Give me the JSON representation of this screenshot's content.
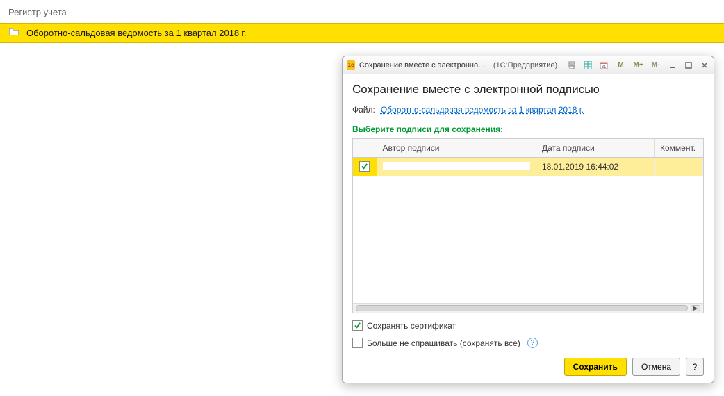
{
  "page": {
    "title": "Регистр учета"
  },
  "yellowBar": {
    "text": "Оборотно-сальдовая ведомость за 1 квартал 2018 г."
  },
  "dialog": {
    "titlePrefix": "Сохранение вместе с электронной подпи...",
    "appSuffix": "(1С:Предприятие)",
    "toolbar": {
      "m1": "M",
      "m2": "M+",
      "m3": "M-"
    },
    "heading": "Сохранение вместе с электронной подписью",
    "fileLabel": "Файл:",
    "fileLink": "Оборотно-сальдовая ведомость за 1 квартал 2018 г.",
    "sectionLabel": "Выберите подписи для сохранения:",
    "table": {
      "columns": {
        "author": "Автор подписи",
        "date": "Дата подписи",
        "comment": "Коммент."
      },
      "rows": [
        {
          "checked": true,
          "author": "",
          "date": "18.01.2019 16:44:02",
          "comment": ""
        }
      ]
    },
    "options": {
      "saveCert": {
        "checked": true,
        "label": "Сохранять сертификат"
      },
      "dontAsk": {
        "checked": false,
        "label": "Больше не спрашивать (сохранять все)"
      }
    },
    "buttons": {
      "save": "Сохранить",
      "cancel": "Отмена",
      "help": "?"
    }
  }
}
